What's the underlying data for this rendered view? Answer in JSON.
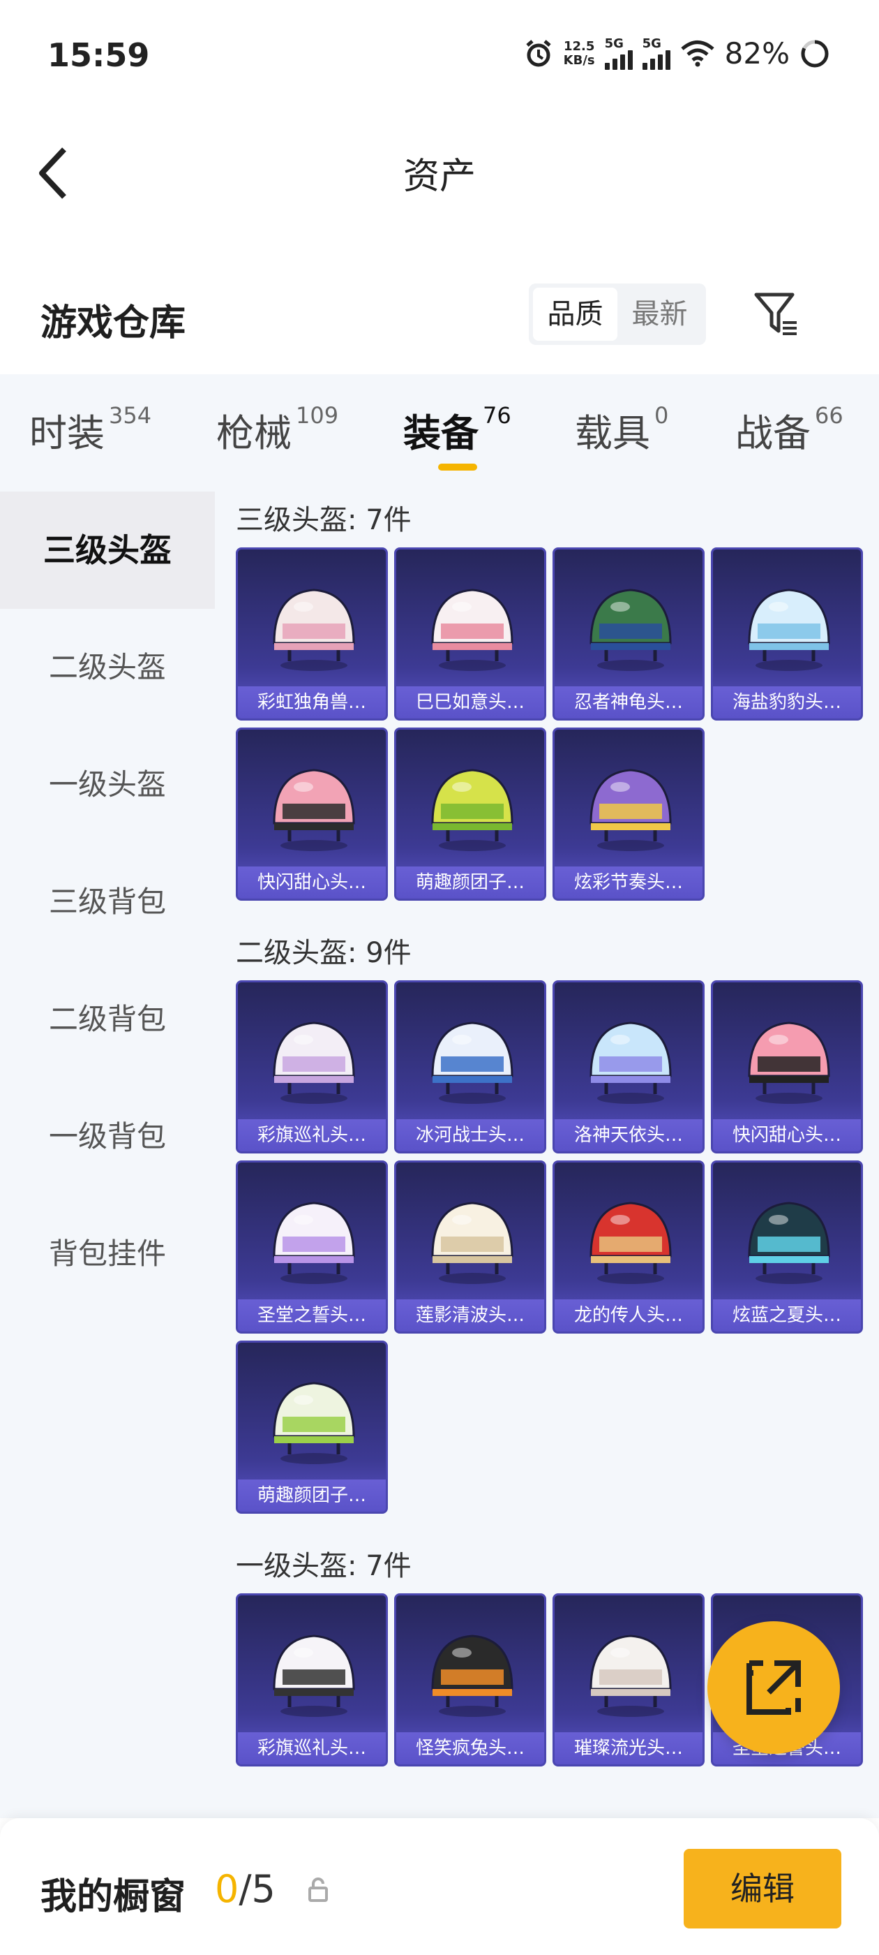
{
  "status": {
    "time": "15:59",
    "net_speed_top": "12.5",
    "net_speed_bottom": "KB/s",
    "net1": "5G",
    "net2": "5G",
    "battery": "82%"
  },
  "header": {
    "title": "资产"
  },
  "section": {
    "title": "游戏仓库",
    "sort_options": [
      "品质",
      "最新"
    ]
  },
  "tabs": [
    {
      "label": "时装",
      "count": "354"
    },
    {
      "label": "枪械",
      "count": "109"
    },
    {
      "label": "装备",
      "count": "76"
    },
    {
      "label": "载具",
      "count": "0"
    },
    {
      "label": "战备",
      "count": "66"
    }
  ],
  "side": [
    "三级头盔",
    "二级头盔",
    "一级头盔",
    "三级背包",
    "二级背包",
    "一级背包",
    "背包挂件"
  ],
  "groups": [
    {
      "title": "三级头盔: 7件",
      "items": [
        "彩虹独角兽…",
        "巳巳如意头…",
        "忍者神龟头…",
        "海盐豹豹头…",
        "快闪甜心头…",
        "萌趣颜团子…",
        "炫彩节奏头…"
      ]
    },
    {
      "title": "二级头盔: 9件",
      "items": [
        "彩旗巡礼头…",
        "冰河战士头…",
        "洛神天依头…",
        "快闪甜心头…",
        "圣堂之誓头…",
        "莲影清波头…",
        "龙的传人头…",
        "炫蓝之夏头…",
        "萌趣颜团子…"
      ]
    },
    {
      "title": "一级头盔: 7件",
      "items": [
        "彩旗巡礼头…",
        "怪笑疯兔头…",
        "璀璨流光头…",
        "圣堂之誓头…"
      ]
    }
  ],
  "bottom": {
    "label": "我的橱窗",
    "current": "0",
    "total": "/5",
    "edit": "编辑"
  },
  "colors": {
    "accent": "#f5b400",
    "card": "#3d3a94"
  }
}
